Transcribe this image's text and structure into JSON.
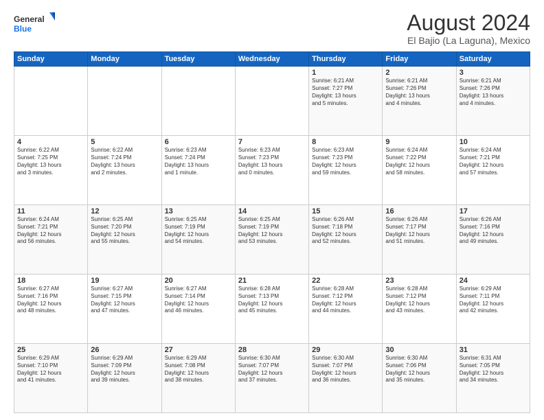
{
  "logo": {
    "line1": "General",
    "line2": "Blue"
  },
  "title": "August 2024",
  "location": "El Bajio (La Laguna), Mexico",
  "weekdays": [
    "Sunday",
    "Monday",
    "Tuesday",
    "Wednesday",
    "Thursday",
    "Friday",
    "Saturday"
  ],
  "weeks": [
    [
      {
        "day": "",
        "info": ""
      },
      {
        "day": "",
        "info": ""
      },
      {
        "day": "",
        "info": ""
      },
      {
        "day": "",
        "info": ""
      },
      {
        "day": "1",
        "info": "Sunrise: 6:21 AM\nSunset: 7:27 PM\nDaylight: 13 hours\nand 5 minutes."
      },
      {
        "day": "2",
        "info": "Sunrise: 6:21 AM\nSunset: 7:26 PM\nDaylight: 13 hours\nand 4 minutes."
      },
      {
        "day": "3",
        "info": "Sunrise: 6:21 AM\nSunset: 7:26 PM\nDaylight: 13 hours\nand 4 minutes."
      }
    ],
    [
      {
        "day": "4",
        "info": "Sunrise: 6:22 AM\nSunset: 7:25 PM\nDaylight: 13 hours\nand 3 minutes."
      },
      {
        "day": "5",
        "info": "Sunrise: 6:22 AM\nSunset: 7:24 PM\nDaylight: 13 hours\nand 2 minutes."
      },
      {
        "day": "6",
        "info": "Sunrise: 6:23 AM\nSunset: 7:24 PM\nDaylight: 13 hours\nand 1 minute."
      },
      {
        "day": "7",
        "info": "Sunrise: 6:23 AM\nSunset: 7:23 PM\nDaylight: 13 hours\nand 0 minutes."
      },
      {
        "day": "8",
        "info": "Sunrise: 6:23 AM\nSunset: 7:23 PM\nDaylight: 12 hours\nand 59 minutes."
      },
      {
        "day": "9",
        "info": "Sunrise: 6:24 AM\nSunset: 7:22 PM\nDaylight: 12 hours\nand 58 minutes."
      },
      {
        "day": "10",
        "info": "Sunrise: 6:24 AM\nSunset: 7:21 PM\nDaylight: 12 hours\nand 57 minutes."
      }
    ],
    [
      {
        "day": "11",
        "info": "Sunrise: 6:24 AM\nSunset: 7:21 PM\nDaylight: 12 hours\nand 56 minutes."
      },
      {
        "day": "12",
        "info": "Sunrise: 6:25 AM\nSunset: 7:20 PM\nDaylight: 12 hours\nand 55 minutes."
      },
      {
        "day": "13",
        "info": "Sunrise: 6:25 AM\nSunset: 7:19 PM\nDaylight: 12 hours\nand 54 minutes."
      },
      {
        "day": "14",
        "info": "Sunrise: 6:25 AM\nSunset: 7:19 PM\nDaylight: 12 hours\nand 53 minutes."
      },
      {
        "day": "15",
        "info": "Sunrise: 6:26 AM\nSunset: 7:18 PM\nDaylight: 12 hours\nand 52 minutes."
      },
      {
        "day": "16",
        "info": "Sunrise: 6:26 AM\nSunset: 7:17 PM\nDaylight: 12 hours\nand 51 minutes."
      },
      {
        "day": "17",
        "info": "Sunrise: 6:26 AM\nSunset: 7:16 PM\nDaylight: 12 hours\nand 49 minutes."
      }
    ],
    [
      {
        "day": "18",
        "info": "Sunrise: 6:27 AM\nSunset: 7:16 PM\nDaylight: 12 hours\nand 48 minutes."
      },
      {
        "day": "19",
        "info": "Sunrise: 6:27 AM\nSunset: 7:15 PM\nDaylight: 12 hours\nand 47 minutes."
      },
      {
        "day": "20",
        "info": "Sunrise: 6:27 AM\nSunset: 7:14 PM\nDaylight: 12 hours\nand 46 minutes."
      },
      {
        "day": "21",
        "info": "Sunrise: 6:28 AM\nSunset: 7:13 PM\nDaylight: 12 hours\nand 45 minutes."
      },
      {
        "day": "22",
        "info": "Sunrise: 6:28 AM\nSunset: 7:12 PM\nDaylight: 12 hours\nand 44 minutes."
      },
      {
        "day": "23",
        "info": "Sunrise: 6:28 AM\nSunset: 7:12 PM\nDaylight: 12 hours\nand 43 minutes."
      },
      {
        "day": "24",
        "info": "Sunrise: 6:29 AM\nSunset: 7:11 PM\nDaylight: 12 hours\nand 42 minutes."
      }
    ],
    [
      {
        "day": "25",
        "info": "Sunrise: 6:29 AM\nSunset: 7:10 PM\nDaylight: 12 hours\nand 41 minutes."
      },
      {
        "day": "26",
        "info": "Sunrise: 6:29 AM\nSunset: 7:09 PM\nDaylight: 12 hours\nand 39 minutes."
      },
      {
        "day": "27",
        "info": "Sunrise: 6:29 AM\nSunset: 7:08 PM\nDaylight: 12 hours\nand 38 minutes."
      },
      {
        "day": "28",
        "info": "Sunrise: 6:30 AM\nSunset: 7:07 PM\nDaylight: 12 hours\nand 37 minutes."
      },
      {
        "day": "29",
        "info": "Sunrise: 6:30 AM\nSunset: 7:07 PM\nDaylight: 12 hours\nand 36 minutes."
      },
      {
        "day": "30",
        "info": "Sunrise: 6:30 AM\nSunset: 7:06 PM\nDaylight: 12 hours\nand 35 minutes."
      },
      {
        "day": "31",
        "info": "Sunrise: 6:31 AM\nSunset: 7:05 PM\nDaylight: 12 hours\nand 34 minutes."
      }
    ]
  ]
}
